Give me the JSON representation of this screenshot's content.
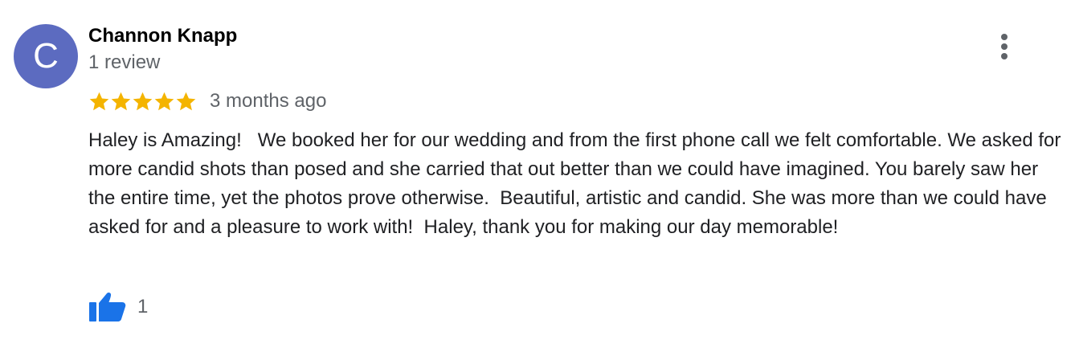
{
  "reviewer": {
    "initial": "C",
    "avatar_color": "#5c6bc0",
    "name": "Channon Knapp",
    "review_count": "1 review"
  },
  "review": {
    "rating": 5,
    "max_rating": 5,
    "star_color": "#f4b400",
    "time_ago": "3 months ago",
    "text": "Haley is Amazing!   We booked her for our wedding and from the first phone call we felt comfortable. We asked for more candid shots than posed and she carried that out better than we could have imagined. You barely saw her the entire time, yet the photos prove otherwise.  Beautiful, artistic and candid. She was more than we could have asked for and a pleasure to work with!  Haley, thank you for making our day memorable!"
  },
  "actions": {
    "like_icon": "thumbs-up-icon",
    "like_icon_color": "#1a73e8",
    "like_count": "1",
    "more_icon": "more-vert-icon"
  }
}
